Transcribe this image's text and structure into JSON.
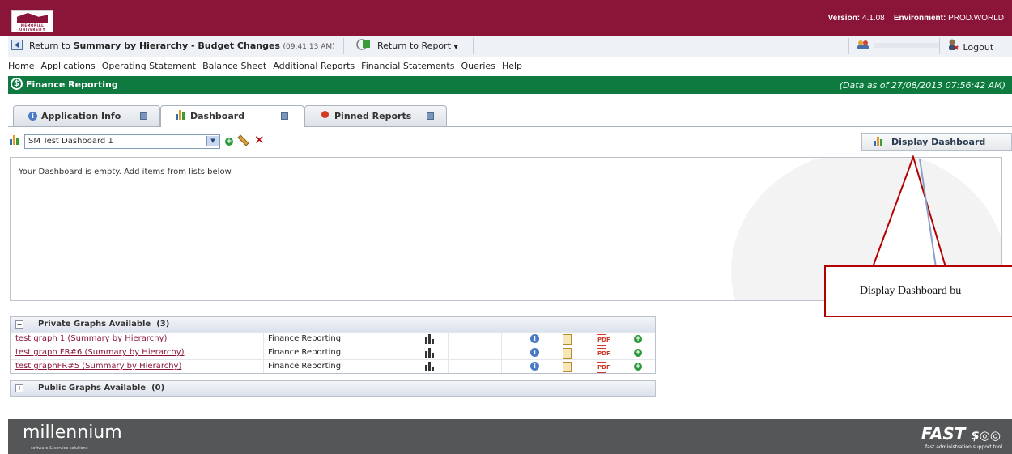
{
  "header": {
    "logo_text": "MEMORIAL UNIVERSITY",
    "version_label": "Version:",
    "version_value": "4.1.08",
    "env_label": "Environment:",
    "env_value": "PROD.WORLD"
  },
  "returnbar": {
    "return_prefix": "Return to",
    "return_target": "Summary by Hierarchy - Budget Changes",
    "return_time": "(09:41:13 AM)",
    "return_to_report": "Return to Report",
    "logout": "Logout"
  },
  "menu": [
    "Home",
    "Applications",
    "Operating Statement",
    "Balance Sheet",
    "Additional Reports",
    "Financial Statements",
    "Queries",
    "Help"
  ],
  "finance": {
    "title": "Finance Reporting",
    "as_of": "(Data as of 27/08/2013 07:56:42 AM)"
  },
  "tabs": [
    {
      "label": "Application Info",
      "active": false
    },
    {
      "label": "Dashboard",
      "active": true
    },
    {
      "label": "Pinned Reports",
      "active": false
    }
  ],
  "dashboard": {
    "selected": "SM Test Dashboard 1",
    "display_button": "Display Dashboard",
    "empty_message": "Your Dashboard is empty. Add items from lists below."
  },
  "callout": {
    "text": "Display Dashboard bu"
  },
  "private_graphs": {
    "header": "Private Graphs Available",
    "count": "(3)",
    "rows": [
      {
        "name": "test graph 1 (Summary by Hierarchy)",
        "app": "Finance Reporting"
      },
      {
        "name": "test graph FR#6 (Summary by Hierarchy)",
        "app": "Finance Reporting"
      },
      {
        "name": "test graphFR#5 (Summary by Hierarchy)",
        "app": "Finance Reporting"
      }
    ]
  },
  "public_graphs": {
    "header": "Public Graphs Available",
    "count": "(0)"
  },
  "footer": {
    "brand": "millennium",
    "brand_sub": "software & service solutions",
    "fast": "FAST",
    "fast_sub": "fast administration support tool"
  },
  "colors": {
    "header_bg": "#8a1538",
    "finance_bar": "#0f7a40",
    "footer_bg": "#555657",
    "callout_border": "#b30000"
  }
}
